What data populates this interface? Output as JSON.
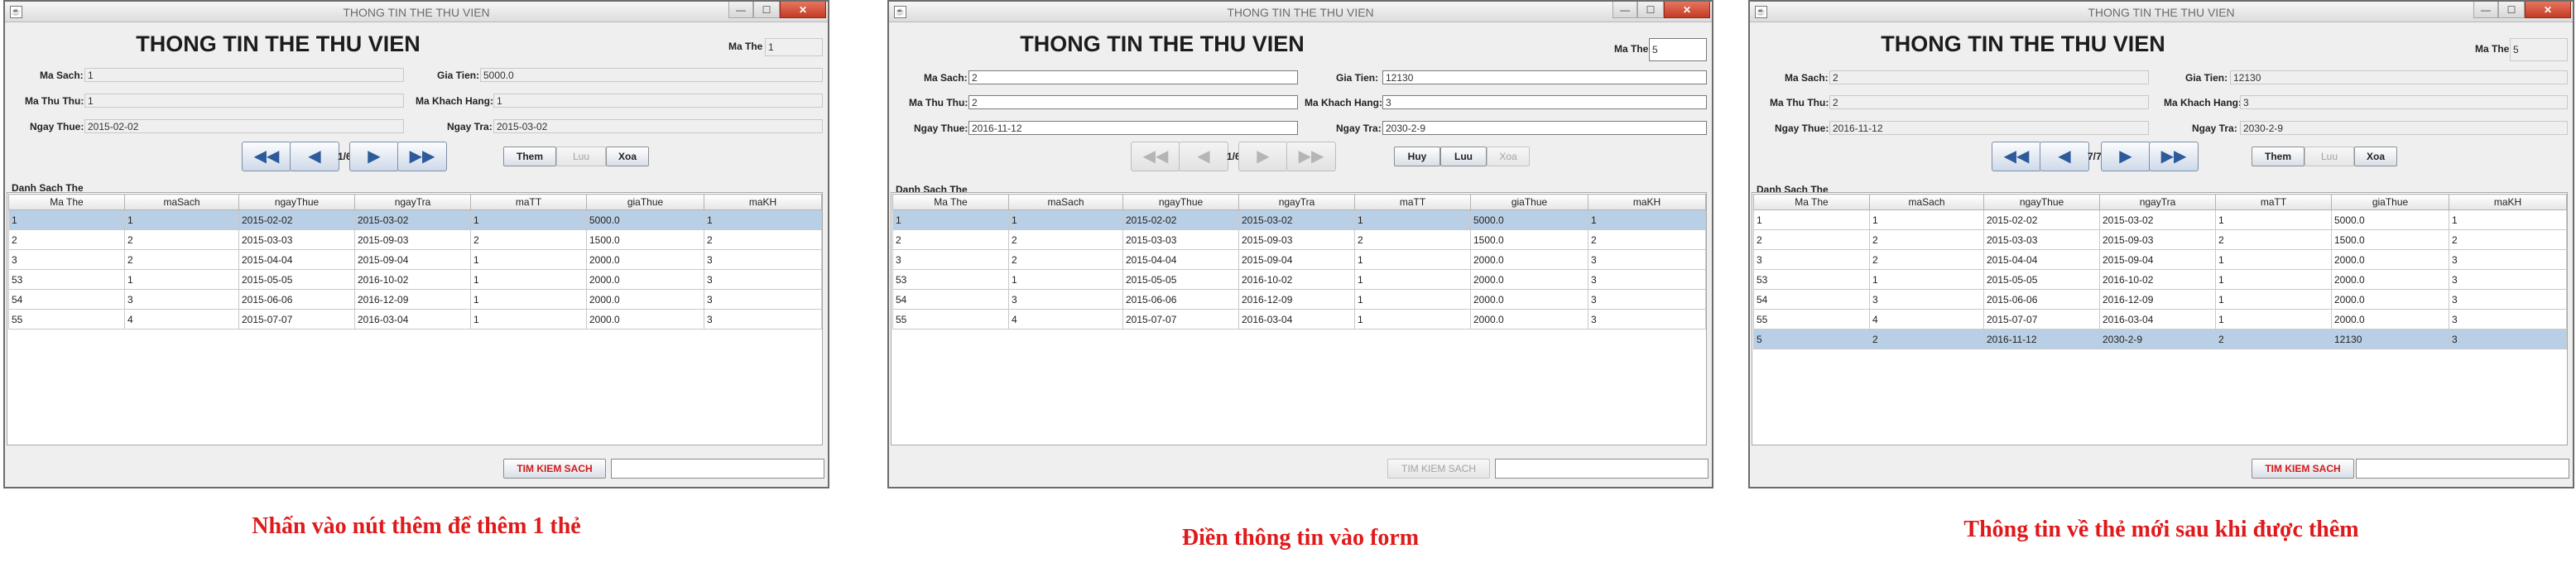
{
  "panels": [
    {
      "window": {
        "title": "THONG TIN THE THU VIEN",
        "min": "—",
        "max": "☐",
        "close": "✕",
        "icon": "java-icon"
      },
      "heading": "THONG TIN THE THU VIEN",
      "labels": {
        "ma_the": "Ma The",
        "ma_sach": "Ma Sach:",
        "gia_tien": "Gia Tien:",
        "ma_thu_thu": "Ma Thu Thu:",
        "ma_khach_hang": "Ma Khach Hang:",
        "ngay_thue": "Ngay Thue:",
        "ngay_tra": "Ngay Tra:"
      },
      "values": {
        "ma_the": "1",
        "ma_sach": "1",
        "gia_tien": "5000.0",
        "ma_thu_thu": "1",
        "ma_khach_hang": "1",
        "ngay_thue": "2015-02-02",
        "ngay_tra": "2015-03-02"
      },
      "nav": {
        "first": "◀◀",
        "prev": "◀",
        "counter": "1/6",
        "next": "▶",
        "last": "▶▶"
      },
      "actions": [
        "Them",
        "Luu",
        "Xoa"
      ],
      "section_title": "Danh Sach The",
      "columns": [
        "Ma The",
        "maSach",
        "ngayThue",
        "ngayTra",
        "maTT",
        "giaThue",
        "maKH"
      ],
      "rows": [
        [
          "1",
          "1",
          "2015-02-02",
          "2015-03-02",
          "1",
          "5000.0",
          "1"
        ],
        [
          "2",
          "2",
          "2015-03-03",
          "2015-09-03",
          "2",
          "1500.0",
          "2"
        ],
        [
          "3",
          "2",
          "2015-04-04",
          "2015-09-04",
          "1",
          "2000.0",
          "3"
        ],
        [
          "53",
          "1",
          "2015-05-05",
          "2016-10-02",
          "1",
          "2000.0",
          "3"
        ],
        [
          "54",
          "3",
          "2015-06-06",
          "2016-12-09",
          "1",
          "2000.0",
          "3"
        ],
        [
          "55",
          "4",
          "2015-07-07",
          "2016-03-04",
          "1",
          "2000.0",
          "3"
        ]
      ],
      "search_label": "TIM KIEM SACH",
      "caption": "Nhấn vào nút thêm để thêm 1 thẻ"
    },
    {
      "window": {
        "title": "THONG TIN THE THU VIEN",
        "min": "—",
        "max": "☐",
        "close": "✕",
        "icon": "java-icon"
      },
      "heading": "THONG TIN THE THU VIEN",
      "labels": {
        "ma_the": "Ma The",
        "ma_sach": "Ma Sach:",
        "gia_tien": "Gia Tien:",
        "ma_thu_thu": "Ma Thu Thu:",
        "ma_khach_hang": "Ma Khach Hang:",
        "ngay_thue": "Ngay Thue:",
        "ngay_tra": "Ngay Tra:"
      },
      "values": {
        "ma_the": "5",
        "ma_sach": "2",
        "gia_tien": "12130",
        "ma_thu_thu": "2",
        "ma_khach_hang": "3",
        "ngay_thue": "2016-11-12",
        "ngay_tra": "2030-2-9"
      },
      "nav": {
        "first": "◀◀",
        "prev": "◀",
        "counter": "1/6",
        "next": "▶",
        "last": "▶▶"
      },
      "actions": [
        "Huy",
        "Luu",
        "Xoa"
      ],
      "section_title": "Danh Sach The",
      "columns": [
        "Ma The",
        "maSach",
        "ngayThue",
        "ngayTra",
        "maTT",
        "giaThue",
        "maKH"
      ],
      "rows": [
        [
          "1",
          "1",
          "2015-02-02",
          "2015-03-02",
          "1",
          "5000.0",
          "1"
        ],
        [
          "2",
          "2",
          "2015-03-03",
          "2015-09-03",
          "2",
          "1500.0",
          "2"
        ],
        [
          "3",
          "2",
          "2015-04-04",
          "2015-09-04",
          "1",
          "2000.0",
          "3"
        ],
        [
          "53",
          "1",
          "2015-05-05",
          "2016-10-02",
          "1",
          "2000.0",
          "3"
        ],
        [
          "54",
          "3",
          "2015-06-06",
          "2016-12-09",
          "1",
          "2000.0",
          "3"
        ],
        [
          "55",
          "4",
          "2015-07-07",
          "2016-03-04",
          "1",
          "2000.0",
          "3"
        ]
      ],
      "search_label": "TIM KIEM SACH",
      "caption": "Điền thông tin vào form"
    },
    {
      "window": {
        "title": "THONG TIN THE THU VIEN",
        "min": "—",
        "max": "☐",
        "close": "✕",
        "icon": "java-icon"
      },
      "heading": "THONG TIN THE THU VIEN",
      "labels": {
        "ma_the": "Ma The",
        "ma_sach": "Ma Sach:",
        "gia_tien": "Gia Tien:",
        "ma_thu_thu": "Ma Thu Thu:",
        "ma_khach_hang": "Ma Khach Hang:",
        "ngay_thue": "Ngay Thue:",
        "ngay_tra": "Ngay Tra:"
      },
      "values": {
        "ma_the": "5",
        "ma_sach": "2",
        "gia_tien": "12130",
        "ma_thu_thu": "2",
        "ma_khach_hang": "3",
        "ngay_thue": "2016-11-12",
        "ngay_tra": "2030-2-9"
      },
      "nav": {
        "first": "◀◀",
        "prev": "◀",
        "counter": "7/7",
        "next": "▶",
        "last": "▶▶"
      },
      "actions": [
        "Them",
        "Luu",
        "Xoa"
      ],
      "section_title": "Danh Sach The",
      "columns": [
        "Ma The",
        "maSach",
        "ngayThue",
        "ngayTra",
        "maTT",
        "giaThue",
        "maKH"
      ],
      "rows": [
        [
          "1",
          "1",
          "2015-02-02",
          "2015-03-02",
          "1",
          "5000.0",
          "1"
        ],
        [
          "2",
          "2",
          "2015-03-03",
          "2015-09-03",
          "2",
          "1500.0",
          "2"
        ],
        [
          "3",
          "2",
          "2015-04-04",
          "2015-09-04",
          "1",
          "2000.0",
          "3"
        ],
        [
          "53",
          "1",
          "2015-05-05",
          "2016-10-02",
          "1",
          "2000.0",
          "3"
        ],
        [
          "54",
          "3",
          "2015-06-06",
          "2016-12-09",
          "1",
          "2000.0",
          "3"
        ],
        [
          "55",
          "4",
          "2015-07-07",
          "2016-03-04",
          "1",
          "2000.0",
          "3"
        ],
        [
          "5",
          "2",
          "2016-11-12",
          "2030-2-9",
          "2",
          "12130",
          "3"
        ]
      ],
      "search_label": "TIM KIEM SACH",
      "caption": "Thông tin về thẻ mới sau khi được thêm"
    }
  ]
}
